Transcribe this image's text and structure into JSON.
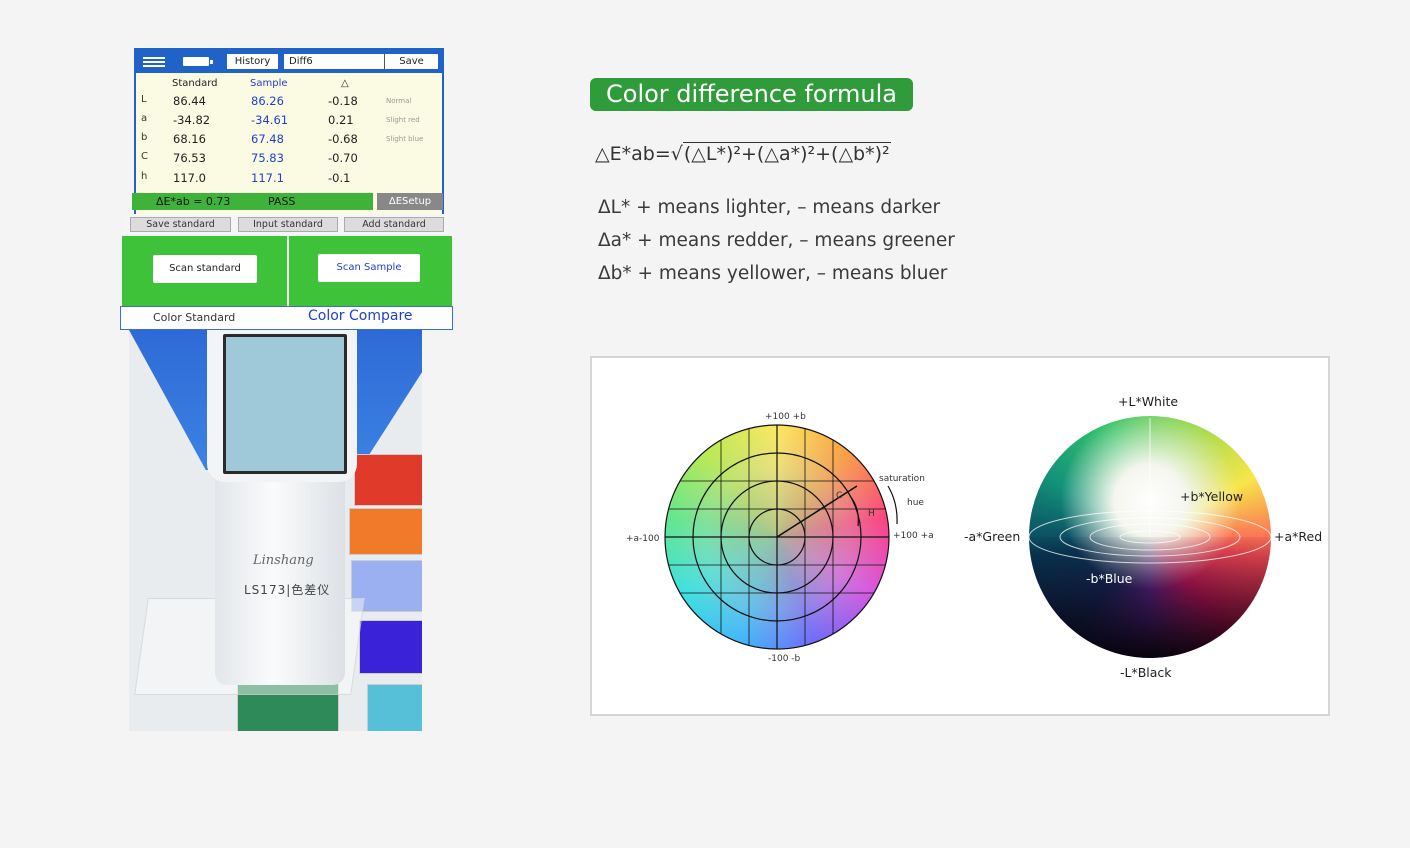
{
  "screen": {
    "toolbar": {
      "history_label": "History",
      "diff_value": "Diff6",
      "save_label": "Save"
    },
    "table": {
      "headers": {
        "standard": "Standard",
        "sample": "Sample",
        "delta": "△"
      },
      "rows": [
        {
          "key": "L",
          "standard": "86.44",
          "sample": "86.26",
          "delta": "-0.18",
          "note": "Normal"
        },
        {
          "key": "a",
          "standard": "-34.82",
          "sample": "-34.61",
          "delta": "0.21",
          "note": "Slight red"
        },
        {
          "key": "b",
          "standard": "68.16",
          "sample": "67.48",
          "delta": "-0.68",
          "note": "Slight blue"
        },
        {
          "key": "C",
          "standard": "76.53",
          "sample": "75.83",
          "delta": "-0.70",
          "note": ""
        },
        {
          "key": "h",
          "standard": "117.0",
          "sample": "117.1",
          "delta": "-0.1",
          "note": ""
        }
      ]
    },
    "result": {
      "delta_e": "ΔE*ab = 0.73",
      "verdict": "PASS",
      "setup_label": "ΔESetup"
    },
    "buttons": {
      "save_standard": "Save standard",
      "input_standard": "Input standard",
      "add_standard": "Add standard",
      "scan_standard": "Scan standard",
      "scan_sample": "Scan Sample"
    },
    "tabs": {
      "color_standard": "Color Standard",
      "color_compare": "Color Compare"
    }
  },
  "photo": {
    "brand": "Linshang",
    "model": "LS173",
    "model_cn": "色差仪"
  },
  "info": {
    "title": "Color difference formula",
    "formula_prefix": "△E*ab=",
    "formula_body": "(△L*)²+(△a*)²+(△b*)²",
    "lines": [
      "ΔL* + means lighter, – means darker",
      "Δa* + means redder, – means greener",
      "Δb* + means yellower, – means bluer"
    ]
  },
  "wheel": {
    "top": "+100 +b",
    "bottom": "-100  -b",
    "left": "+a-100",
    "right": "+100 +a",
    "saturation": "saturation",
    "hue": "hue",
    "c": "C",
    "h": "H"
  },
  "sphere": {
    "top": "+L*White",
    "bottom": "-L*Black",
    "left": "-a*Green",
    "right": "+a*Red",
    "yellow": "+b*Yellow",
    "blue": "-b*Blue"
  },
  "colors": {
    "accent_blue": "#1f63c9",
    "pass_green": "#3fb23a",
    "badge_green": "#2f9b3a",
    "sample_blue": "#1f3fd0"
  }
}
